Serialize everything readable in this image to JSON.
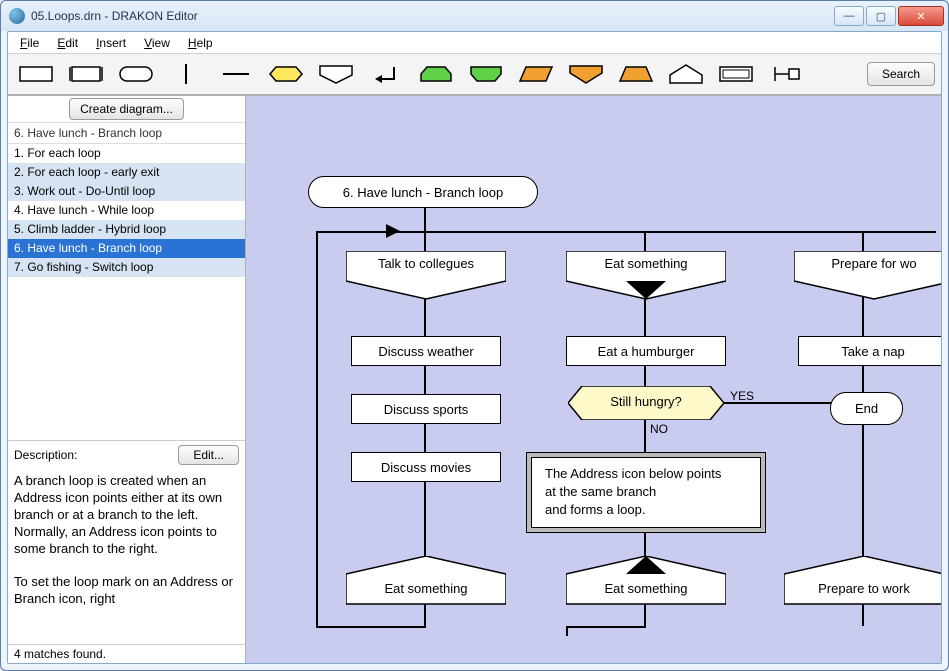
{
  "window": {
    "title": "05.Loops.drn - DRAKON Editor"
  },
  "menu": {
    "file": "File",
    "edit": "Edit",
    "insert": "Insert",
    "view": "View",
    "help": "Help"
  },
  "toolbar": {
    "search": "Search"
  },
  "sidebar": {
    "create": "Create diagram...",
    "context": "6. Have lunch - Branch loop",
    "items": [
      "1. For each loop",
      "2. For each loop - early exit",
      "3. Work out - Do-Until loop",
      "4. Have lunch - While loop",
      "5. Climb ladder - Hybrid loop",
      "6. Have lunch - Branch loop",
      "7. Go fishing - Switch loop"
    ],
    "desc_label": "Description:",
    "edit": "Edit...",
    "description": "A branch loop is created when an Address icon points either at its own branch or at a branch to the left. Normally, an Address icon points to some branch to the right.\n\nTo set the loop mark on an Address or Branch icon, right"
  },
  "status": "4 matches found.",
  "diagram": {
    "title": "6. Have lunch - Branch loop",
    "b1": "Talk to collegues",
    "b2": "Eat something",
    "b3": "Prepare for wo",
    "a1": "Discuss weather",
    "a2": "Discuss sports",
    "a3": "Discuss movies",
    "a4": "Eat a humburger",
    "q1": "Still hungry?",
    "yes": "YES",
    "no": "NO",
    "comment": "The Address icon below points\nat the same branch\nand forms a loop.",
    "addr1": "Eat something",
    "addr2": "Eat something",
    "addr3": "Prepare to work",
    "nap": "Take a nap",
    "end": "End"
  }
}
